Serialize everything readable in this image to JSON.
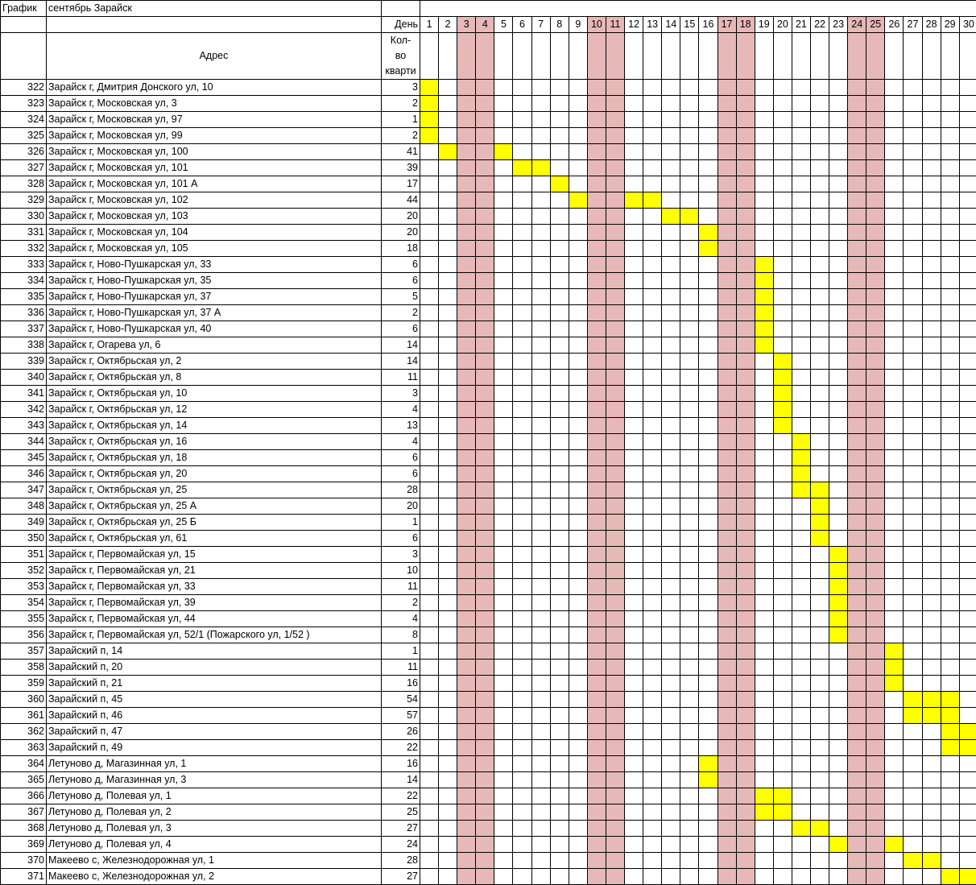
{
  "sheet": {
    "label_grafik": "График",
    "title": "сентябрь Зарайск",
    "day_header": "День",
    "address_header": "Адрес",
    "qty_header_lines": [
      "Кол-",
      "во",
      "кварти"
    ],
    "weekend_color": "#e6b8b7",
    "mark_color": "#ffff00",
    "days": [
      "1",
      "2",
      "3",
      "4",
      "5",
      "6",
      "7",
      "8",
      "9",
      "10",
      "11",
      "12",
      "13",
      "14",
      "15",
      "16",
      "17",
      "18",
      "19",
      "20",
      "21",
      "22",
      "23",
      "24",
      "25",
      "26",
      "27",
      "28",
      "29",
      "30"
    ],
    "weekend_days": [
      3,
      4,
      10,
      11,
      17,
      18,
      24,
      25
    ],
    "rows": [
      {
        "n": "322",
        "addr": "Зарайск г, Дмитрия Донского ул, 10",
        "qty": "3",
        "marks": [
          1
        ]
      },
      {
        "n": "323",
        "addr": "Зарайск г, Московская ул, 3",
        "qty": "2",
        "marks": [
          1
        ]
      },
      {
        "n": "324",
        "addr": "Зарайск г, Московская ул, 97",
        "qty": "1",
        "marks": [
          1
        ]
      },
      {
        "n": "325",
        "addr": "Зарайск г, Московская ул, 99",
        "qty": "2",
        "marks": [
          1
        ]
      },
      {
        "n": "326",
        "addr": "Зарайск г, Московская ул, 100",
        "qty": "41",
        "marks": [
          2,
          5
        ]
      },
      {
        "n": "327",
        "addr": "Зарайск г, Московская ул, 101",
        "qty": "39",
        "marks": [
          6,
          7
        ]
      },
      {
        "n": "328",
        "addr": "Зарайск г, Московская ул, 101 А",
        "qty": "17",
        "marks": [
          8
        ]
      },
      {
        "n": "329",
        "addr": "Зарайск г, Московская ул, 102",
        "qty": "44",
        "marks": [
          9,
          12,
          13
        ]
      },
      {
        "n": "330",
        "addr": "Зарайск г, Московская ул, 103",
        "qty": "20",
        "marks": [
          14,
          15
        ]
      },
      {
        "n": "331",
        "addr": "Зарайск г, Московская ул, 104",
        "qty": "20",
        "marks": [
          16
        ]
      },
      {
        "n": "332",
        "addr": "Зарайск г, Московская ул, 105",
        "qty": "18",
        "marks": [
          16
        ]
      },
      {
        "n": "333",
        "addr": "Зарайск г, Ново-Пушкарская ул, 33",
        "qty": "6",
        "marks": [
          19
        ]
      },
      {
        "n": "334",
        "addr": "Зарайск г, Ново-Пушкарская ул, 35",
        "qty": "6",
        "marks": [
          19
        ]
      },
      {
        "n": "335",
        "addr": "Зарайск г, Ново-Пушкарская ул, 37",
        "qty": "5",
        "marks": [
          19
        ]
      },
      {
        "n": "336",
        "addr": "Зарайск г, Ново-Пушкарская ул, 37 А",
        "qty": "2",
        "marks": [
          19
        ]
      },
      {
        "n": "337",
        "addr": "Зарайск г, Ново-Пушкарская ул, 40",
        "qty": "6",
        "marks": [
          19
        ]
      },
      {
        "n": "338",
        "addr": "Зарайск г, Огарева ул, 6",
        "qty": "14",
        "marks": [
          19
        ]
      },
      {
        "n": "339",
        "addr": "Зарайск г, Октябрьская ул, 2",
        "qty": "14",
        "marks": [
          20
        ]
      },
      {
        "n": "340",
        "addr": "Зарайск г, Октябрьская ул, 8",
        "qty": "11",
        "marks": [
          20
        ]
      },
      {
        "n": "341",
        "addr": "Зарайск г, Октябрьская ул, 10",
        "qty": "3",
        "marks": [
          20
        ]
      },
      {
        "n": "342",
        "addr": "Зарайск г, Октябрьская ул, 12",
        "qty": "4",
        "marks": [
          20
        ]
      },
      {
        "n": "343",
        "addr": "Зарайск г, Октябрьская ул, 14",
        "qty": "13",
        "marks": [
          20
        ]
      },
      {
        "n": "344",
        "addr": "Зарайск г, Октябрьская ул, 16",
        "qty": "4",
        "marks": [
          21
        ]
      },
      {
        "n": "345",
        "addr": "Зарайск г, Октябрьская ул, 18",
        "qty": "6",
        "marks": [
          21
        ]
      },
      {
        "n": "346",
        "addr": "Зарайск г, Октябрьская ул, 20",
        "qty": "6",
        "marks": [
          21
        ]
      },
      {
        "n": "347",
        "addr": "Зарайск г, Октябрьская ул, 25",
        "qty": "28",
        "marks": [
          21,
          22
        ]
      },
      {
        "n": "348",
        "addr": "Зарайск г, Октябрьская ул, 25 А",
        "qty": "20",
        "marks": [
          22
        ]
      },
      {
        "n": "349",
        "addr": "Зарайск г, Октябрьская ул, 25 Б",
        "qty": "1",
        "marks": [
          22
        ]
      },
      {
        "n": "350",
        "addr": "Зарайск г, Октябрьская ул, 61",
        "qty": "6",
        "marks": [
          22
        ]
      },
      {
        "n": "351",
        "addr": "Зарайск г, Первомайская ул, 15",
        "qty": "3",
        "marks": [
          23
        ]
      },
      {
        "n": "352",
        "addr": "Зарайск г, Первомайская ул, 21",
        "qty": "10",
        "marks": [
          23
        ]
      },
      {
        "n": "353",
        "addr": "Зарайск г, Первомайская ул, 33",
        "qty": "11",
        "marks": [
          23
        ]
      },
      {
        "n": "354",
        "addr": "Зарайск г, Первомайская ул, 39",
        "qty": "2",
        "marks": [
          23
        ]
      },
      {
        "n": "355",
        "addr": "Зарайск г, Первомайская ул, 44",
        "qty": "4",
        "marks": [
          23
        ]
      },
      {
        "n": "356",
        "addr": "Зарайск г, Первомайская ул, 52/1 (Пожарского ул, 1/52 )",
        "qty": "8",
        "marks": [
          23
        ]
      },
      {
        "n": "357",
        "addr": "Зарайский п, 14",
        "qty": "1",
        "marks": [
          26
        ]
      },
      {
        "n": "358",
        "addr": "Зарайский п, 20",
        "qty": "11",
        "marks": [
          26
        ]
      },
      {
        "n": "359",
        "addr": "Зарайский п, 21",
        "qty": "16",
        "marks": [
          26
        ]
      },
      {
        "n": "360",
        "addr": "Зарайский п, 45",
        "qty": "54",
        "marks": [
          27,
          28,
          29
        ]
      },
      {
        "n": "361",
        "addr": "Зарайский п, 46",
        "qty": "57",
        "marks": [
          27,
          28,
          29
        ]
      },
      {
        "n": "362",
        "addr": "Зарайский п, 47",
        "qty": "26",
        "marks": [
          29,
          30
        ]
      },
      {
        "n": "363",
        "addr": "Зарайский п, 49",
        "qty": "22",
        "marks": [
          29,
          30
        ]
      },
      {
        "n": "364",
        "addr": "Летуново д, Магазинная ул, 1",
        "qty": "16",
        "marks": [
          16
        ]
      },
      {
        "n": "365",
        "addr": "Летуново д, Магазинная ул, 3",
        "qty": "14",
        "marks": [
          16
        ]
      },
      {
        "n": "366",
        "addr": "Летуново д, Полевая ул, 1",
        "qty": "22",
        "marks": [
          19,
          20
        ]
      },
      {
        "n": "367",
        "addr": "Летуново д, Полевая ул, 2",
        "qty": "25",
        "marks": [
          19,
          20
        ]
      },
      {
        "n": "368",
        "addr": "Летуново д, Полевая ул, 3",
        "qty": "27",
        "marks": [
          21,
          22
        ]
      },
      {
        "n": "369",
        "addr": "Летуново д, Полевая ул, 4",
        "qty": "24",
        "marks": [
          23,
          26
        ]
      },
      {
        "n": "370",
        "addr": "Макеево с, Железнодорожная ул, 1",
        "qty": "28",
        "marks": [
          27,
          28
        ]
      },
      {
        "n": "371",
        "addr": "Макеево с, Железнодорожная ул, 2",
        "qty": "27",
        "marks": [
          29,
          30
        ]
      }
    ]
  }
}
